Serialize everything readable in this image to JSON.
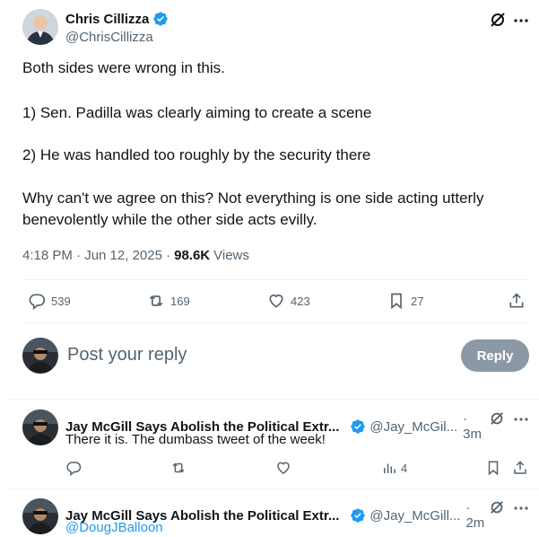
{
  "main_tweet": {
    "author_name": "Chris Cillizza",
    "author_handle": "@ChrisCillizza",
    "lines": [
      "Both sides were wrong in this.",
      "1) Sen. Padilla was clearly aiming to create a scene",
      "2) He was handled too roughly by the security there",
      "Why can't we agree on this? Not everything is one side acting utterly",
      "benevolently while the other side acts evilly."
    ],
    "timestamp": "4:18 PM · Jun 12, 2025 ·",
    "views_count": "98.6K",
    "views_label": "Views",
    "stats": {
      "replies": "539",
      "reposts": "169",
      "likes": "423",
      "bookmarks": "27"
    }
  },
  "reply_box": {
    "placeholder": "Post your reply",
    "button_label": "Reply"
  },
  "replies": [
    {
      "author_name": "Jay McGill Says Abolish the Political Extr...",
      "author_handle": "@Jay_McGil...",
      "time": "· 3m",
      "text": "There it is. The dumbass tweet of the week!",
      "views": "4"
    },
    {
      "author_name": "Jay McGill Says Abolish the Political Extr...",
      "author_handle": "@Jay_McGill...",
      "time": "· 2m",
      "text": "@DougJBalloon"
    }
  ],
  "colors": {
    "verified_blue": "#1d9bf0",
    "muted": "#536471",
    "link_blue": "#1d9bf0",
    "reply_button": "#8b98a5"
  }
}
